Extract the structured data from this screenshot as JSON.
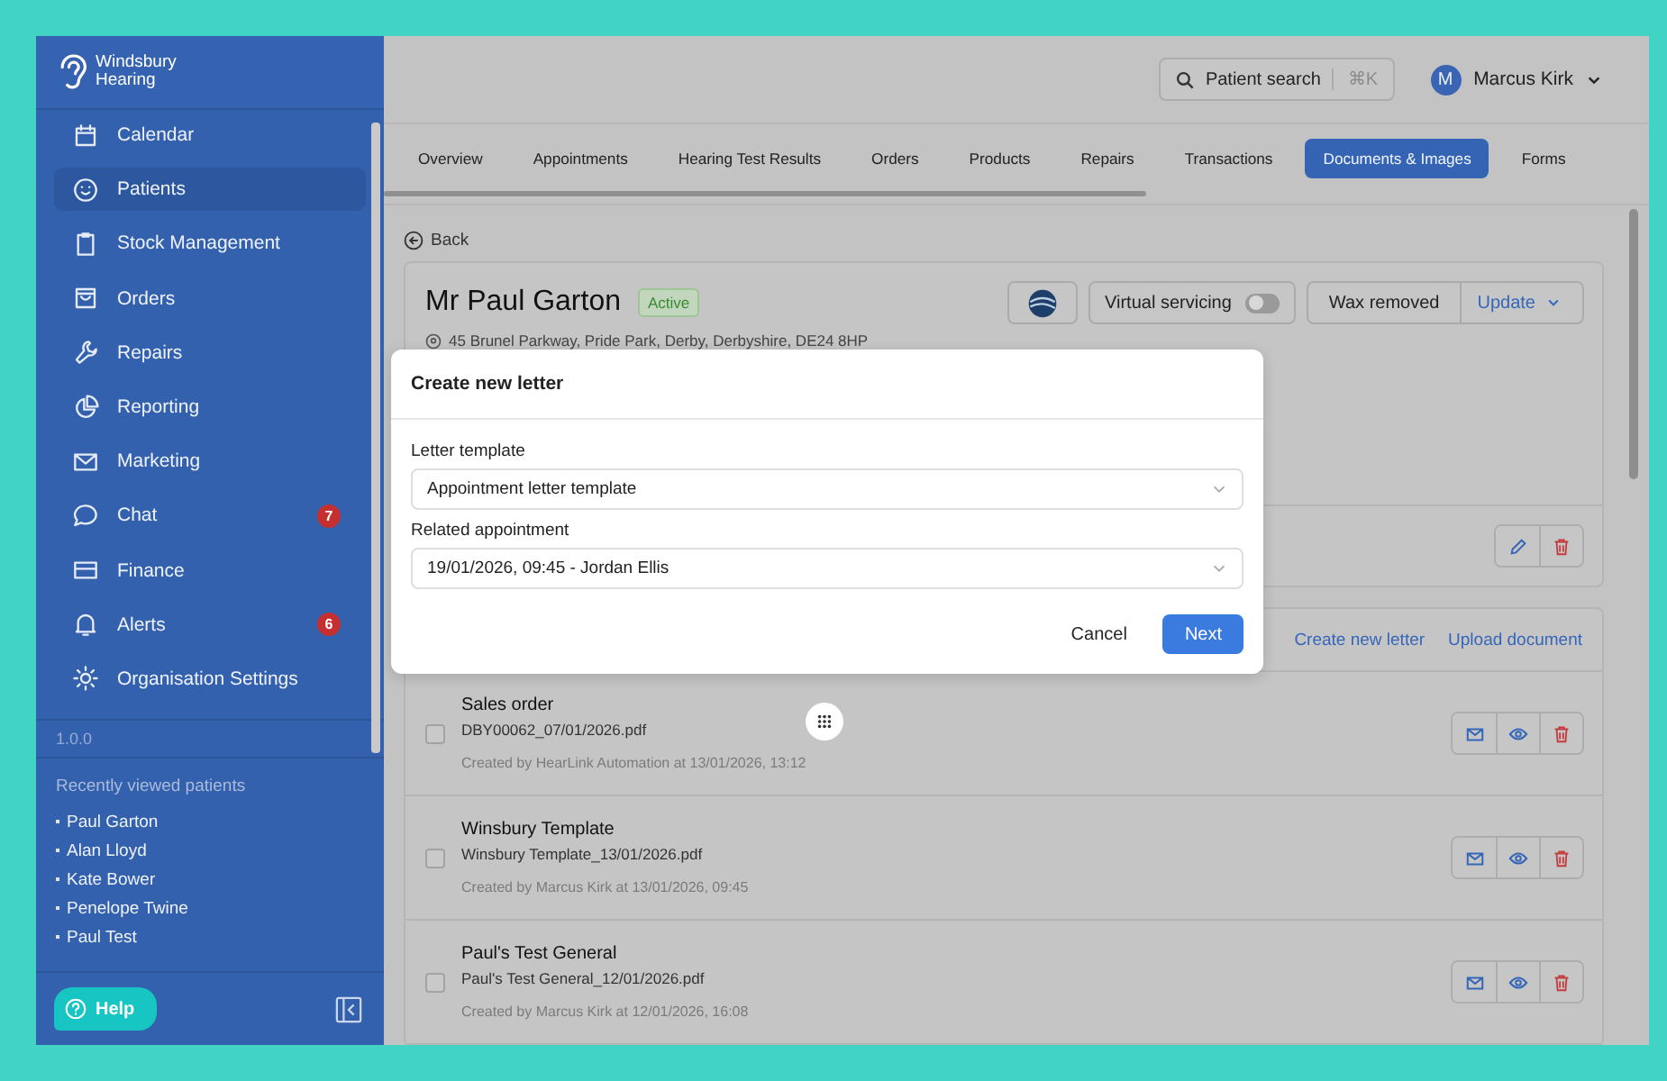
{
  "brand": {
    "line1": "Windsbury",
    "line2": "Hearing"
  },
  "nav": [
    {
      "label": "Calendar",
      "selected": false
    },
    {
      "label": "Patients",
      "selected": true
    },
    {
      "label": "Stock Management",
      "selected": false
    },
    {
      "label": "Orders",
      "selected": false
    },
    {
      "label": "Repairs",
      "selected": false
    },
    {
      "label": "Reporting",
      "selected": false
    },
    {
      "label": "Marketing",
      "selected": false
    },
    {
      "label": "Chat",
      "selected": false,
      "badge": "7"
    },
    {
      "label": "Finance",
      "selected": false
    },
    {
      "label": "Alerts",
      "selected": false,
      "badge": "6"
    },
    {
      "label": "Organisation Settings",
      "selected": false
    }
  ],
  "version": "1.0.0",
  "recent": {
    "title": "Recently viewed patients",
    "items": [
      "Paul Garton",
      "Alan Lloyd",
      "Kate Bower",
      "Penelope Twine",
      "Paul Test"
    ]
  },
  "help": "Help",
  "search": {
    "label": "Patient search",
    "shortcut": "⌘K"
  },
  "user": {
    "initial": "M",
    "name": "Marcus Kirk"
  },
  "tabs": [
    {
      "label": "Overview",
      "selected": false
    },
    {
      "label": "Appointments",
      "selected": false
    },
    {
      "label": "Hearing Test Results",
      "selected": false
    },
    {
      "label": "Orders",
      "selected": false
    },
    {
      "label": "Products",
      "selected": false
    },
    {
      "label": "Repairs",
      "selected": false
    },
    {
      "label": "Transactions",
      "selected": false
    },
    {
      "label": "Documents & Images",
      "selected": true
    },
    {
      "label": "Forms",
      "selected": false
    }
  ],
  "back": "Back",
  "patient": {
    "name": "Mr Paul Garton",
    "status": "Active",
    "address": "45 Brunel Parkway, Pride Park, Derby, Derbyshire, DE24 8HP",
    "virtual_servicing": {
      "label": "Virtual servicing",
      "on": false
    },
    "wax": "Wax removed",
    "update": "Update"
  },
  "documents": {
    "actions": [
      "Create new letter",
      "Upload document"
    ],
    "rows": [
      {
        "title": "Sales order",
        "file": "DBY00062_07/01/2026.pdf",
        "meta": "Created by HearLink Automation at 13/01/2026, 13:12",
        "checked": false
      },
      {
        "title": "Winsbury Template",
        "file": "Winsbury Template_13/01/2026.pdf",
        "meta": "Created by Marcus Kirk at 13/01/2026, 09:45",
        "checked": false
      },
      {
        "title": "Paul's Test General",
        "file": "Paul's Test General_12/01/2026.pdf",
        "meta": "Created by Marcus Kirk at 12/01/2026, 16:08",
        "checked": false
      }
    ]
  },
  "modal": {
    "title": "Create new letter",
    "fields": [
      {
        "label": "Letter template",
        "value": "Appointment letter template"
      },
      {
        "label": "Related appointment",
        "value": "19/01/2026, 09:45 - Jordan Ellis"
      }
    ],
    "buttons": [
      {
        "label": "Cancel",
        "kind": "secondary"
      },
      {
        "label": "Next",
        "kind": "primary"
      }
    ]
  }
}
